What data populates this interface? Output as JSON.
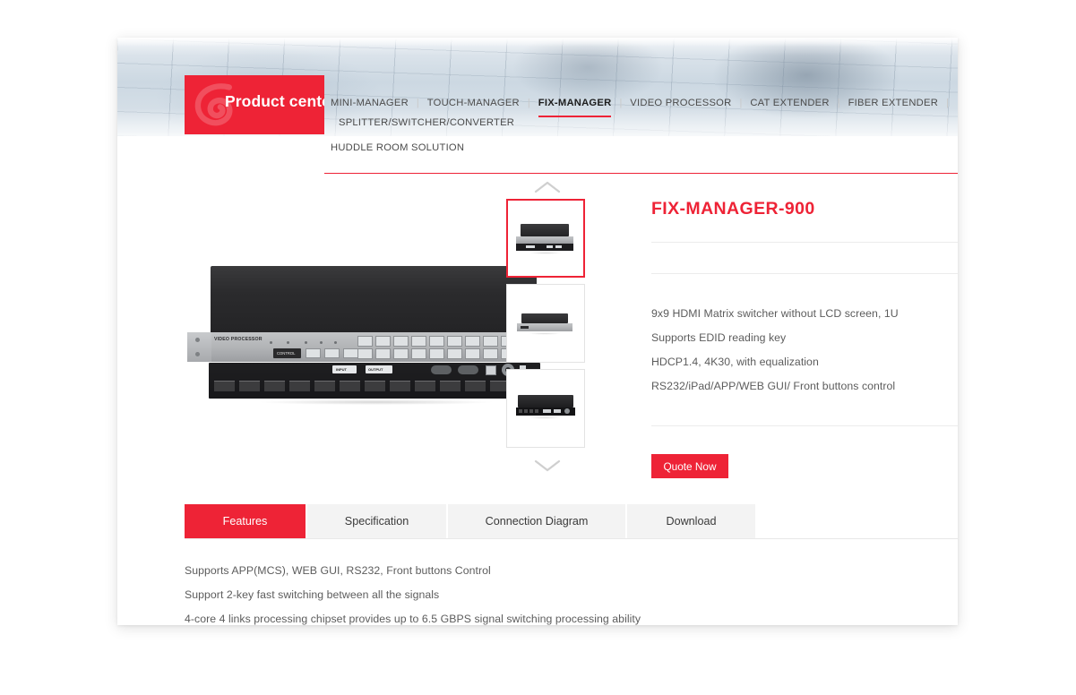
{
  "brand": {
    "accent_red": "#ee2336",
    "product_center_label": "Product center",
    "logo_icon": "spiral-logo-icon"
  },
  "nav": {
    "row1": [
      {
        "label": "MINI-MANAGER",
        "active": false
      },
      {
        "label": "TOUCH-MANAGER",
        "active": false
      },
      {
        "label": "FIX-MANAGER",
        "active": true
      },
      {
        "label": "VIDEO PROCESSOR",
        "active": false
      },
      {
        "label": "CAT EXTENDER",
        "active": false
      },
      {
        "label": "FIBER EXTENDER",
        "active": false
      },
      {
        "label": "SPLITTER/SWITCHER/CONVERTER",
        "active": false
      }
    ],
    "row2": [
      {
        "label": "HUDDLE ROOM SOLUTION",
        "active": false
      }
    ],
    "separator": "|"
  },
  "gallery": {
    "prev_icon": "chevron-up-icon",
    "next_icon": "chevron-down-icon",
    "main_image_alt": "FIX-MANAGER-900 video processor front and rear view",
    "thumbnails": [
      {
        "alt": "FIX-MANAGER-900 front angled view",
        "selected": true
      },
      {
        "alt": "FIX-MANAGER-900 front view",
        "selected": false
      },
      {
        "alt": "FIX-MANAGER-900 rear panel view",
        "selected": false
      }
    ]
  },
  "product": {
    "title": "FIX-MANAGER-900",
    "specs": [
      "9x9 HDMI Matrix switcher without LCD screen, 1U",
      "Supports EDID reading key",
      "HDCP1.4, 4K30, with equalization",
      "RS232/iPad/APP/WEB GUI/ Front buttons control"
    ],
    "quote_button_label": "Quote Now"
  },
  "tabs": [
    {
      "label": "Features",
      "active": true
    },
    {
      "label": "Specification",
      "active": false
    },
    {
      "label": "Connection Diagram",
      "active": false
    },
    {
      "label": "Download",
      "active": false
    }
  ],
  "features": [
    "Supports APP(MCS), WEB GUI, RS232, Front buttons Control",
    "Support 2-key fast switching between all the signals",
    "4-core 4 links processing chipset provides up to 6.5 GBPS signal switching processing ability"
  ],
  "device_labels": {
    "panel_title": "VIDEO PROCESSOR",
    "control": "CONTROL",
    "in_put": "IN PUT",
    "out_put": "OUT PUT",
    "input": "INPUT",
    "output": "OUTPUT"
  }
}
